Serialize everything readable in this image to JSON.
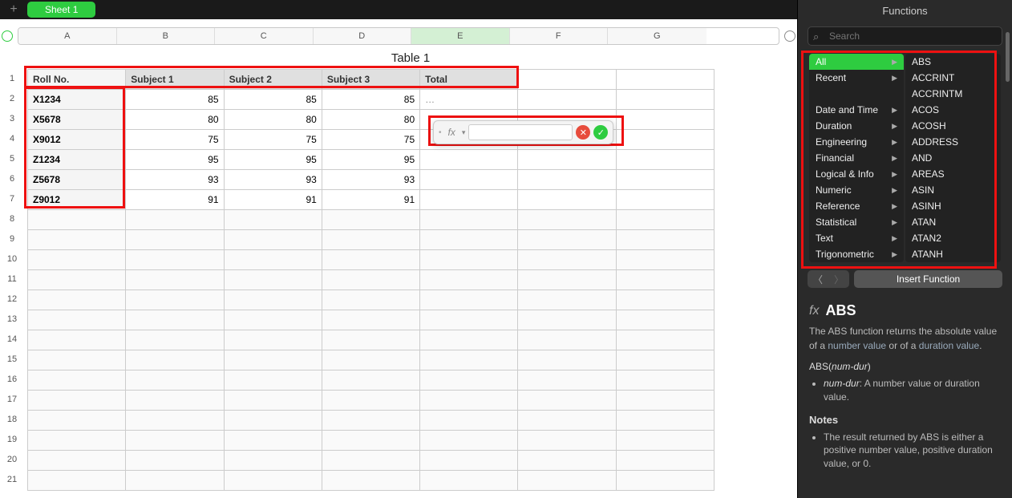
{
  "tabs": {
    "add_tooltip": "+",
    "sheet_label": "Sheet 1"
  },
  "panel_title": "Functions",
  "search": {
    "placeholder": "Search"
  },
  "table": {
    "title": "Table 1",
    "columns": [
      "A",
      "B",
      "C",
      "D",
      "E",
      "F",
      "G"
    ],
    "active_col": "E",
    "headers": [
      "Roll No.",
      "Subject 1",
      "Subject 2",
      "Subject 3",
      "Total"
    ],
    "rows": [
      {
        "roll": "X1234",
        "s1": 85,
        "s2": 85,
        "s3": 85,
        "total": "…",
        "editing": true
      },
      {
        "roll": "X5678",
        "s1": 80,
        "s2": 80,
        "s3": 80,
        "total": ""
      },
      {
        "roll": "X9012",
        "s1": 75,
        "s2": 75,
        "s3": 75,
        "total": ""
      },
      {
        "roll": "Z1234",
        "s1": 95,
        "s2": 95,
        "s3": 95,
        "total": ""
      },
      {
        "roll": "Z5678",
        "s1": 93,
        "s2": 93,
        "s3": 93,
        "total": ""
      },
      {
        "roll": "Z9012",
        "s1": 91,
        "s2": 91,
        "s3": 91,
        "total": ""
      }
    ],
    "row_numbers": [
      1,
      2,
      3,
      4,
      5,
      6,
      7,
      8,
      9,
      10,
      11,
      12,
      13,
      14,
      15,
      16,
      17,
      18,
      19,
      20,
      21
    ]
  },
  "formula_popup": {
    "fx_label": "fx",
    "value": ""
  },
  "categories": [
    {
      "label": "All",
      "active": true
    },
    {
      "label": "Recent"
    },
    {
      "label": ""
    },
    {
      "label": "Date and Time"
    },
    {
      "label": "Duration"
    },
    {
      "label": "Engineering"
    },
    {
      "label": "Financial"
    },
    {
      "label": "Logical & Info"
    },
    {
      "label": "Numeric"
    },
    {
      "label": "Reference"
    },
    {
      "label": "Statistical"
    },
    {
      "label": "Text"
    },
    {
      "label": "Trigonometric"
    }
  ],
  "functions": [
    "ABS",
    "ACCRINT",
    "ACCRINTM",
    "ACOS",
    "ACOSH",
    "ADDRESS",
    "AND",
    "AREAS",
    "ASIN",
    "ASINH",
    "ATAN",
    "ATAN2",
    "ATANH"
  ],
  "insert_label": "Insert Function",
  "detail": {
    "name": "ABS",
    "desc_1": "The ABS function returns the absolute value of a ",
    "desc_link1": "number value",
    "desc_2": " or of a ",
    "desc_link2": "duration value",
    "desc_3": ".",
    "syntax_pre": "ABS(",
    "syntax_arg": "num-dur",
    "syntax_post": ")",
    "arg_name": "num-dur",
    "arg_desc": ": A number value or duration value.",
    "notes_title": "Notes",
    "note1": "The result returned by ABS is either a positive number value, positive duration value, or 0."
  }
}
